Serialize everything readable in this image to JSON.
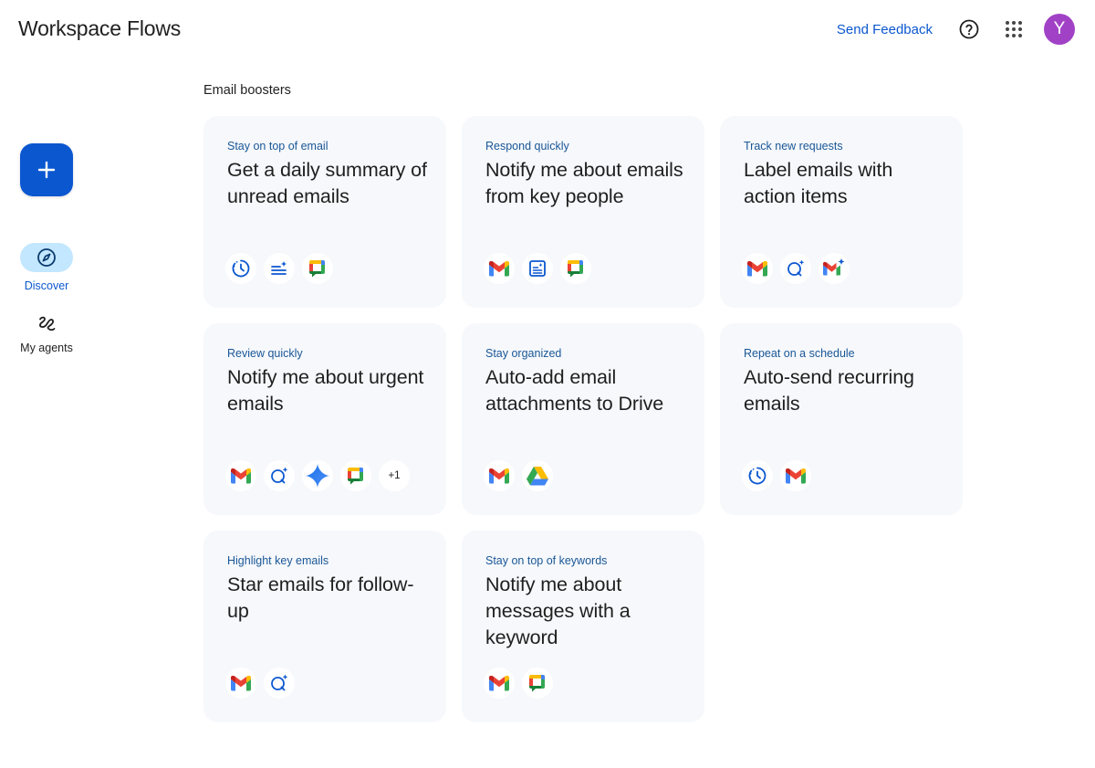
{
  "app": {
    "title": "Workspace Flows"
  },
  "header": {
    "feedback_label": "Send Feedback",
    "help_icon": "help-circle-icon",
    "apps_icon": "apps-grid-icon",
    "avatar_initial": "Y",
    "avatar_color": "#a142c6"
  },
  "rail": {
    "fab_icon": "plus-icon",
    "items": [
      {
        "label": "Discover",
        "icon": "compass-icon",
        "active": true
      },
      {
        "label": "My agents",
        "icon": "agents-icon",
        "active": false
      }
    ]
  },
  "main": {
    "section_title": "Email boosters",
    "cards": [
      {
        "kicker": "Stay on top of email",
        "title": "Get a daily summary of unread emails",
        "icons": [
          "schedule-icon",
          "summarize-icon",
          "google-chat-icon"
        ]
      },
      {
        "kicker": "Respond quickly",
        "title": "Notify me about emails from key people",
        "icons": [
          "gmail-icon",
          "extract-icon",
          "google-chat-icon"
        ]
      },
      {
        "kicker": "Track new requests",
        "title": "Label emails with action items",
        "icons": [
          "gmail-icon",
          "ask-gemini-icon",
          "gmail-ai-icon"
        ]
      },
      {
        "kicker": "Review quickly",
        "title": "Notify me about urgent emails",
        "icons": [
          "gmail-icon",
          "ask-gemini-icon",
          "gemini-icon",
          "google-chat-icon"
        ],
        "more": "+1"
      },
      {
        "kicker": "Stay organized",
        "title": "Auto-add email attachments to Drive",
        "icons": [
          "gmail-icon",
          "google-drive-icon"
        ]
      },
      {
        "kicker": "Repeat on a schedule",
        "title": "Auto-send recurring emails",
        "icons": [
          "schedule-icon",
          "gmail-icon"
        ]
      },
      {
        "kicker": "Highlight key emails",
        "title": "Star emails for follow-up",
        "icons": [
          "gmail-icon",
          "ask-gemini-icon"
        ]
      },
      {
        "kicker": "Stay on top of keywords",
        "title": "Notify me about messages with a keyword",
        "icons": [
          "gmail-icon",
          "google-chat-icon"
        ]
      }
    ]
  },
  "colors": {
    "accent": "#0b57d0",
    "card_bg": "#f6f8fc",
    "rail_active": "#c2e7ff"
  }
}
